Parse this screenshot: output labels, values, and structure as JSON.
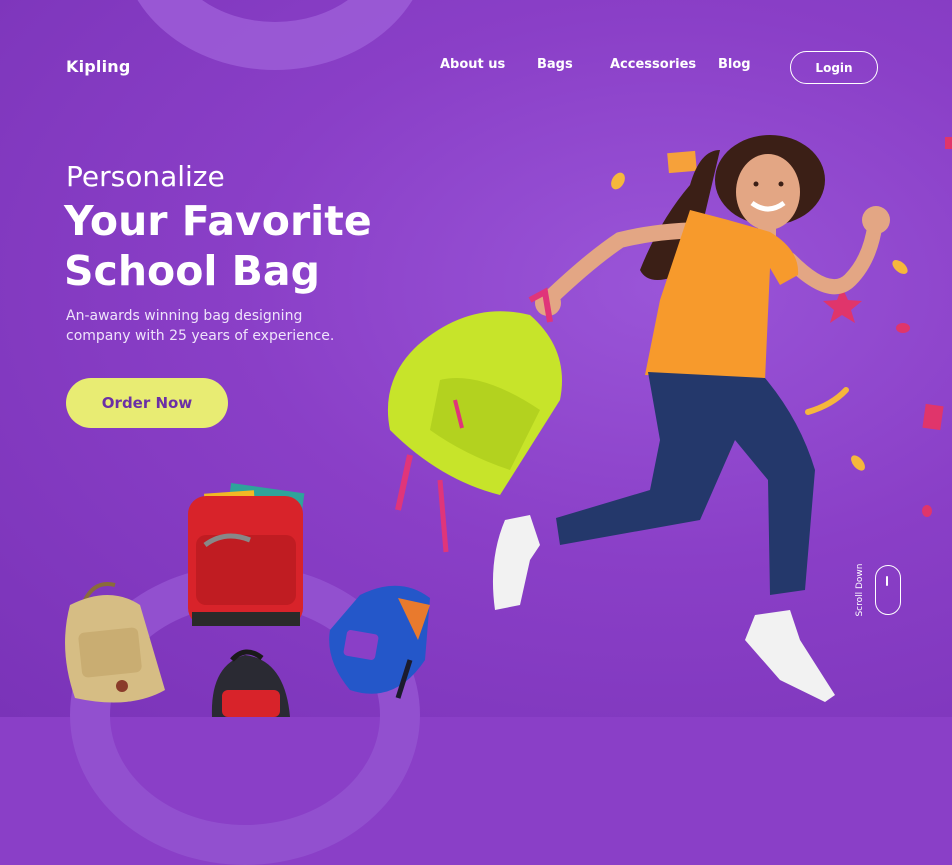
{
  "brand": {
    "name": "Kipling"
  },
  "nav": {
    "items": [
      {
        "label": "About us"
      },
      {
        "label": "Bags"
      },
      {
        "label": "Accessories"
      },
      {
        "label": "Blog"
      }
    ],
    "login_label": "Login"
  },
  "hero": {
    "kicker": "Personalize",
    "title": "Your Favorite School Bag",
    "subtitle": "An-awards winning bag designing company with 25 years of experience.",
    "cta_label": "Order Now"
  },
  "scroll": {
    "label": "Scroll Down"
  },
  "colors": {
    "background": "#8a3fc7",
    "cta": "#e8ec73",
    "cta_text": "#6b2fa6"
  }
}
